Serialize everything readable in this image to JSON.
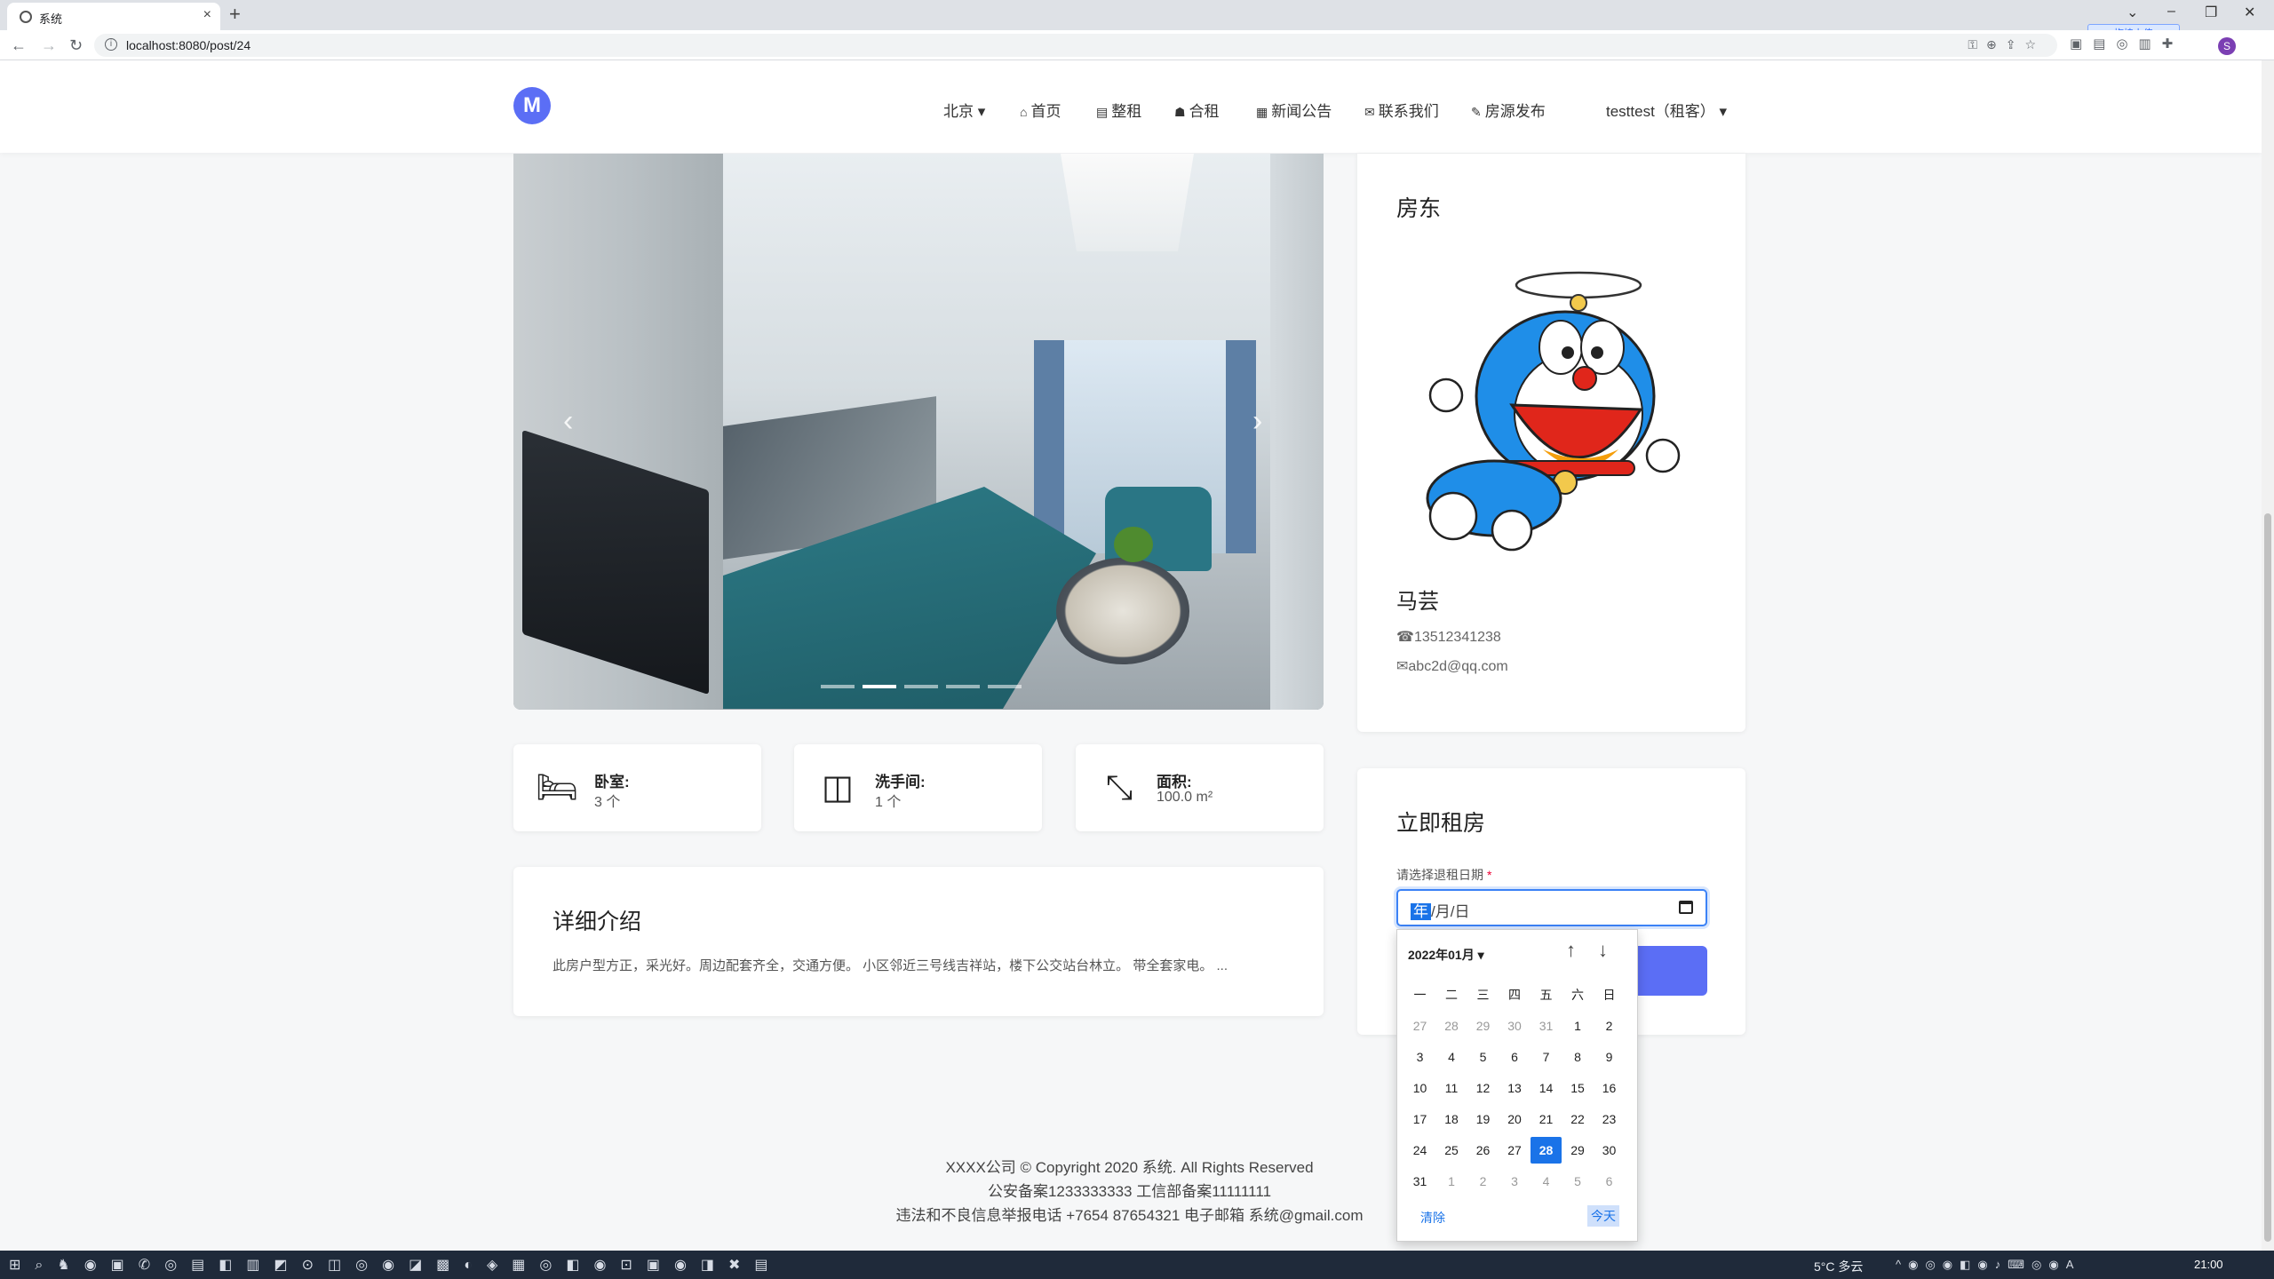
{
  "browser": {
    "tab_title": "系统",
    "url": "localhost:8080/post/24",
    "extension_tooltip": "拖拽上传",
    "profile_initial": "S"
  },
  "nav": {
    "city": "北京",
    "home": "首页",
    "whole_rent": "整租",
    "shared_rent": "合租",
    "news": "新闻公告",
    "contact": "联系我们",
    "publish": "房源发布",
    "user": "testtest（租客）"
  },
  "carousel": {
    "slide_count": 5,
    "active_index": 1
  },
  "stats": [
    {
      "label": "卧室:",
      "value": "3 个",
      "icon": "bed-icon"
    },
    {
      "label": "洗手间:",
      "value": "1 个",
      "icon": "toilet-icon"
    },
    {
      "label": "面积:",
      "value": "100.0 m²",
      "icon": "area-icon"
    }
  ],
  "detail": {
    "title": "详细介绍",
    "text": "此房户型方正，采光好。周边配套齐全，交通方便。 小区邻近三号线吉祥站，楼下公交站台林立。 带全套家电。 ..."
  },
  "landlord": {
    "title": "房东",
    "name": "马芸",
    "phone": "13512341238",
    "email": "abc2d@qq.com"
  },
  "rent": {
    "title": "立即租房",
    "label": "请选择退租日期",
    "required_mark": "*",
    "date_year": "年",
    "date_rest": "/月/日"
  },
  "picker": {
    "month": "2022年01月",
    "weekdays": [
      "一",
      "二",
      "三",
      "四",
      "五",
      "六",
      "日"
    ],
    "weeks": [
      [
        [
          "27",
          1
        ],
        [
          "28",
          1
        ],
        [
          "29",
          1
        ],
        [
          "30",
          1
        ],
        [
          "31",
          1
        ],
        [
          "1",
          0
        ],
        [
          "2",
          0
        ]
      ],
      [
        [
          "3",
          0
        ],
        [
          "4",
          0
        ],
        [
          "5",
          0
        ],
        [
          "6",
          0
        ],
        [
          "7",
          0
        ],
        [
          "8",
          0
        ],
        [
          "9",
          0
        ]
      ],
      [
        [
          "10",
          0
        ],
        [
          "11",
          0
        ],
        [
          "12",
          0
        ],
        [
          "13",
          0
        ],
        [
          "14",
          0
        ],
        [
          "15",
          0
        ],
        [
          "16",
          0
        ]
      ],
      [
        [
          "17",
          0
        ],
        [
          "18",
          0
        ],
        [
          "19",
          0
        ],
        [
          "20",
          0
        ],
        [
          "21",
          0
        ],
        [
          "22",
          0
        ],
        [
          "23",
          0
        ]
      ],
      [
        [
          "24",
          0
        ],
        [
          "25",
          0
        ],
        [
          "26",
          0
        ],
        [
          "27",
          0
        ],
        [
          "28",
          2
        ],
        [
          "29",
          0
        ],
        [
          "30",
          0
        ]
      ],
      [
        [
          "31",
          0
        ],
        [
          "1",
          1
        ],
        [
          "2",
          1
        ],
        [
          "3",
          1
        ],
        [
          "4",
          1
        ],
        [
          "5",
          1
        ],
        [
          "6",
          1
        ]
      ]
    ],
    "clear": "清除",
    "today": "今天"
  },
  "footer": {
    "line1": "XXXX公司 © Copyright 2020 系统. All Rights Reserved",
    "line2": "公安备案1233333333 工信部备案11111111",
    "line3": "违法和不良信息举报电话 +7654 87654321 电子邮箱 系统@gmail.com"
  },
  "taskbar": {
    "weather": "5°C 多云",
    "time": "21:00"
  },
  "colors": {
    "accent": "#5b6ef5",
    "picker_selected": "#1a73e8"
  }
}
